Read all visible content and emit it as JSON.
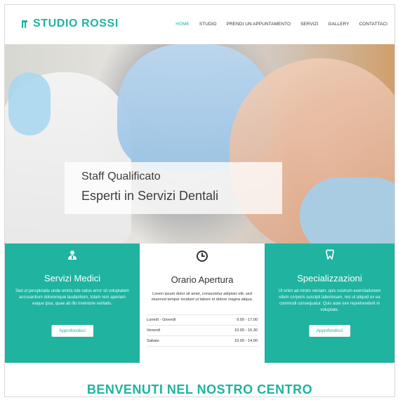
{
  "brand": {
    "name": "STUDIO ROSSI",
    "accent": "#1fb3a0"
  },
  "nav": {
    "items": [
      "HOME",
      "STUDIO",
      "PRENDI UN APPUNTAMENTO",
      "SERVIZI",
      "GALLERY",
      "CONTATTACI"
    ],
    "active_index": 0
  },
  "hero": {
    "line1": "Staff Qualificato",
    "line2": "Esperti in Servizi Dentali"
  },
  "features": {
    "servizi": {
      "title": "Servizi Medici",
      "desc": "Sed ut perspiciatis unde omnis iste natus error sit voluptatem accusantium doloremque laudantium, totam rem aperiam eaque ipsa, quae ab illo inventore veritatis.",
      "button": "Approfondisci",
      "icon": "doctor-icon"
    },
    "orario": {
      "title": "Orario Apertura",
      "desc": "Lorem ipsum dolor sit amet, consectetur adipisici elit, sed eiusmod tempor incidunt ut labore et dolore magna aliqua.",
      "icon": "clock-icon",
      "rows": [
        {
          "day": "Lunedì - Giovedì",
          "time": "9.00 - 17.00"
        },
        {
          "day": "Venerdì",
          "time": "10.00 - 15.30"
        },
        {
          "day": "Sabato",
          "time": "10.00 - 14.00"
        }
      ]
    },
    "specializzazioni": {
      "title": "Specializzazioni",
      "desc": "Ut enim ad minim veniam, quis nostrum exercitationem ullam corporis suscipit laboriosam, nisi ut aliquid ex ea commodi consequatur. Quis aute iure reprehenderit in voluptate.",
      "button": "Approfondisci",
      "icon": "tooth-icon"
    }
  },
  "welcome": {
    "title": "BENVENUTI NEL NOSTRO CENTRO"
  }
}
